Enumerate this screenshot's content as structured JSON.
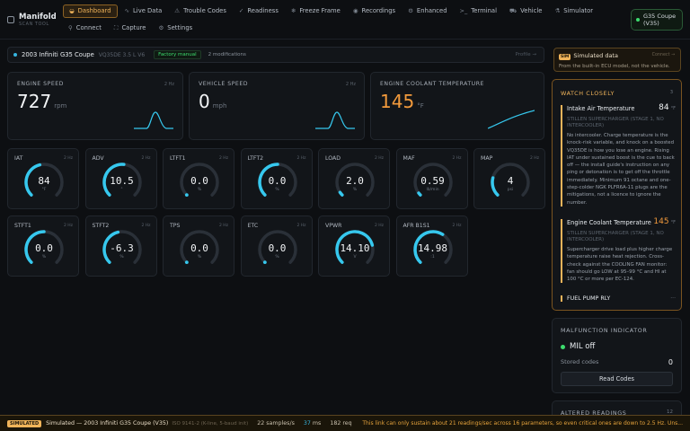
{
  "brand": {
    "name": "Manifold",
    "sub": "SCAN TOOL"
  },
  "nav": [
    {
      "label": "Dashboard",
      "icon": "◒",
      "active": true
    },
    {
      "label": "Live Data",
      "icon": "∿"
    },
    {
      "label": "Trouble Codes",
      "icon": "⚠"
    },
    {
      "label": "Readiness",
      "icon": "✓"
    },
    {
      "label": "Freeze Frame",
      "icon": "❄"
    },
    {
      "label": "Recordings",
      "icon": "◉"
    },
    {
      "label": "Enhanced",
      "icon": "⚙"
    },
    {
      "label": "Terminal",
      "icon": ">_"
    },
    {
      "label": "Vehicle",
      "icon": "⛟"
    },
    {
      "label": "Simulator",
      "icon": "⚗"
    },
    {
      "label": "Connect",
      "icon": "⚲"
    },
    {
      "label": "Capture",
      "icon": "⛶"
    },
    {
      "label": "Settings",
      "icon": "⚙"
    }
  ],
  "vehicle_pill": {
    "label": "G35 Coupe (V35)",
    "color": "#3ddc6e"
  },
  "vehicle_bar": {
    "title": "2003 Infiniti G35 Coupe",
    "engine": "VQ35DE 3.5 L V6",
    "factory": "Factory manual",
    "mods": "2 modifications",
    "profile": "Profile →"
  },
  "big_panels": [
    {
      "label": "ENGINE SPEED",
      "hz": "2 Hz",
      "value": "727",
      "unit": "rpm",
      "warm": false
    },
    {
      "label": "VEHICLE SPEED",
      "hz": "2 Hz",
      "value": "0",
      "unit": "mph",
      "warm": false
    },
    {
      "label": "ENGINE COOLANT TEMPERATURE",
      "hz": "",
      "value": "145",
      "unit": "°F",
      "warm": true
    }
  ],
  "gauges": [
    {
      "label": "IAT",
      "hz": "2 Hz",
      "value": "84",
      "unit": "°F",
      "level": 0.45
    },
    {
      "label": "ADV",
      "hz": "2 Hz",
      "value": "10.5",
      "unit": "°",
      "level": 0.52
    },
    {
      "label": "LTFT1",
      "hz": "2 Hz",
      "value": "0.0",
      "unit": "%",
      "level": 0.0
    },
    {
      "label": "LTFT2",
      "hz": "2 Hz",
      "value": "0.0",
      "unit": "%",
      "level": 0.5
    },
    {
      "label": "LOAD",
      "hz": "2 Hz",
      "value": "2.0",
      "unit": "%",
      "level": 0.04
    },
    {
      "label": "MAF",
      "hz": "2 Hz",
      "value": "0.59",
      "unit": "lb/min",
      "level": 0.03
    },
    {
      "label": "MAP",
      "hz": "2 Hz",
      "value": "4",
      "unit": "psi",
      "level": 0.22
    },
    {
      "label": "STFT1",
      "hz": "2 Hz",
      "value": "0.0",
      "unit": "%",
      "level": 0.5
    },
    {
      "label": "STFT2",
      "hz": "2 Hz",
      "value": "-6.3",
      "unit": "%",
      "level": 0.45
    },
    {
      "label": "TPS",
      "hz": "2 Hz",
      "value": "0.0",
      "unit": "%",
      "level": 0.0
    },
    {
      "label": "ETC",
      "hz": "2 Hz",
      "value": "0.0",
      "unit": "%",
      "level": 0.0
    },
    {
      "label": "VPWR",
      "hz": "2 Hz",
      "value": "14.10",
      "unit": "V",
      "level": 0.78
    },
    {
      "label": "AFR B1S1",
      "hz": "2 Hz",
      "value": "14.98",
      "unit": ":1",
      "level": 0.62
    }
  ],
  "sim": {
    "tag": "SIM",
    "title": "Simulated data",
    "action": "Connect →",
    "desc": "From the built-in ECU model, not the vehicle."
  },
  "watch": {
    "title": "WATCH CLOSELY",
    "count": "3",
    "items": [
      {
        "title": "Intake Air Temperature",
        "value": "84",
        "unit": "°F",
        "sub": "STILLEN SUPERCHARGER (STAGE 1, NO INTERCOOLER)",
        "desc": "No intercooler. Charge temperature is the knock-risk variable, and knock on a boosted VQ35DE is how you lose an engine. Rising IAT under sustained boost is the cue to back off — the install guide's instruction on any ping or detonation is to get off the throttle immediately. Minimum 91 octane and one-step-colder NGK PLFR6A-11 plugs are the mitigations, not a licence to ignore the number."
      },
      {
        "title": "Engine Coolant Temperature",
        "value": "145",
        "unit": "°F",
        "sub": "STILLEN SUPERCHARGER (STAGE 1, NO INTERCOOLER)",
        "desc": "Supercharger drive load plus higher charge temperature raise heat rejection. Cross-check against the COOLING FAN monitor: fan should go LOW at 95–99 °C and HI at 100 °C or more per EC-124."
      },
      {
        "title": "FUEL PUMP RLY",
        "more": "···"
      }
    ]
  },
  "mil": {
    "title": "MALFUNCTION INDICATOR",
    "status": "MIL off",
    "stored_label": "Stored codes",
    "stored_count": "0",
    "button": "Read Codes"
  },
  "altered": {
    "title": "ALTERED READINGS",
    "count": "12"
  },
  "status": {
    "tag": "SIMULATED",
    "summary": "Simulated — 2003 Infiniti G35 Coupe (V35)",
    "protocol": "ISO 9141-2 (K-line, 5-baud init)",
    "rate_value": "22",
    "rate_label": "samples/s",
    "latency_value": "37",
    "latency_label": "ms",
    "req_value": "182",
    "req_label": "req",
    "warning": "This link can only sustain about 21 readings/sec across 16 parameters, so even critical ones are down to 2.5 Hz. Uns..."
  },
  "colors": {
    "accent": "#f0b45a",
    "gauge": "#36c8ee",
    "ok": "#3ddc6e",
    "warm": "#f29a3c"
  }
}
